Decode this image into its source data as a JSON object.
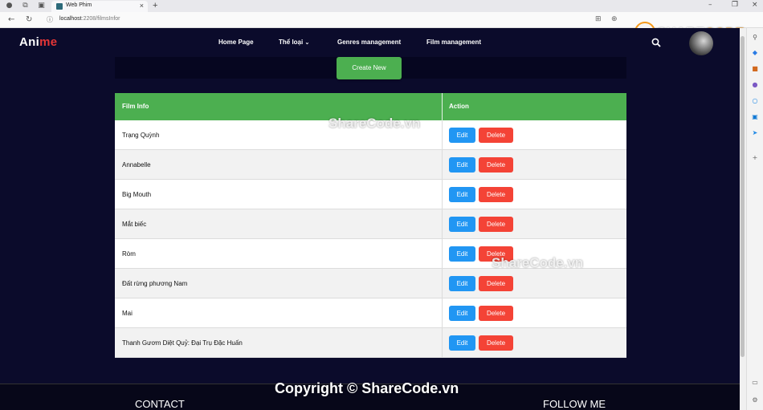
{
  "browser": {
    "tab_title": "Web Phim",
    "url_host": "localhost",
    "url_path": ":2208/filmsInfor"
  },
  "header": {
    "logo_main": "Ani",
    "logo_accent": "me",
    "menu": {
      "home": "Home Page",
      "genre": "Thể loại",
      "genres_mgmt": "Genres management",
      "film_mgmt": "Film management"
    }
  },
  "actions": {
    "create_new": "Create New"
  },
  "table": {
    "col_film_info": "Film Info",
    "col_action": "Action",
    "edit_label": "Edit",
    "delete_label": "Delete",
    "rows": [
      "Trạng Quỳnh",
      "Annabelle",
      "Big Mouth",
      "Mắt biếc",
      "Ròm",
      "Đất rừng phương Nam",
      "Mai",
      "Thanh Gươm Diệt Quỷ: Đại Trụ Đặc Huấn"
    ]
  },
  "footer": {
    "contact": "CONTACT",
    "follow": "FOLLOW ME"
  },
  "watermark": {
    "logo_share": "SHARE",
    "logo_code": "CODE",
    "logo_tld": ".vn",
    "text_1": "ShareCode.vn",
    "text_2": "ShareCode.vn",
    "copyright": "Copyright © ShareCode.vn"
  },
  "colors": {
    "page_bg": "#0b0b2b",
    "accent_red": "#e53637",
    "green": "#4caf50",
    "edit_blue": "#2196f3",
    "delete_red": "#f44336"
  }
}
